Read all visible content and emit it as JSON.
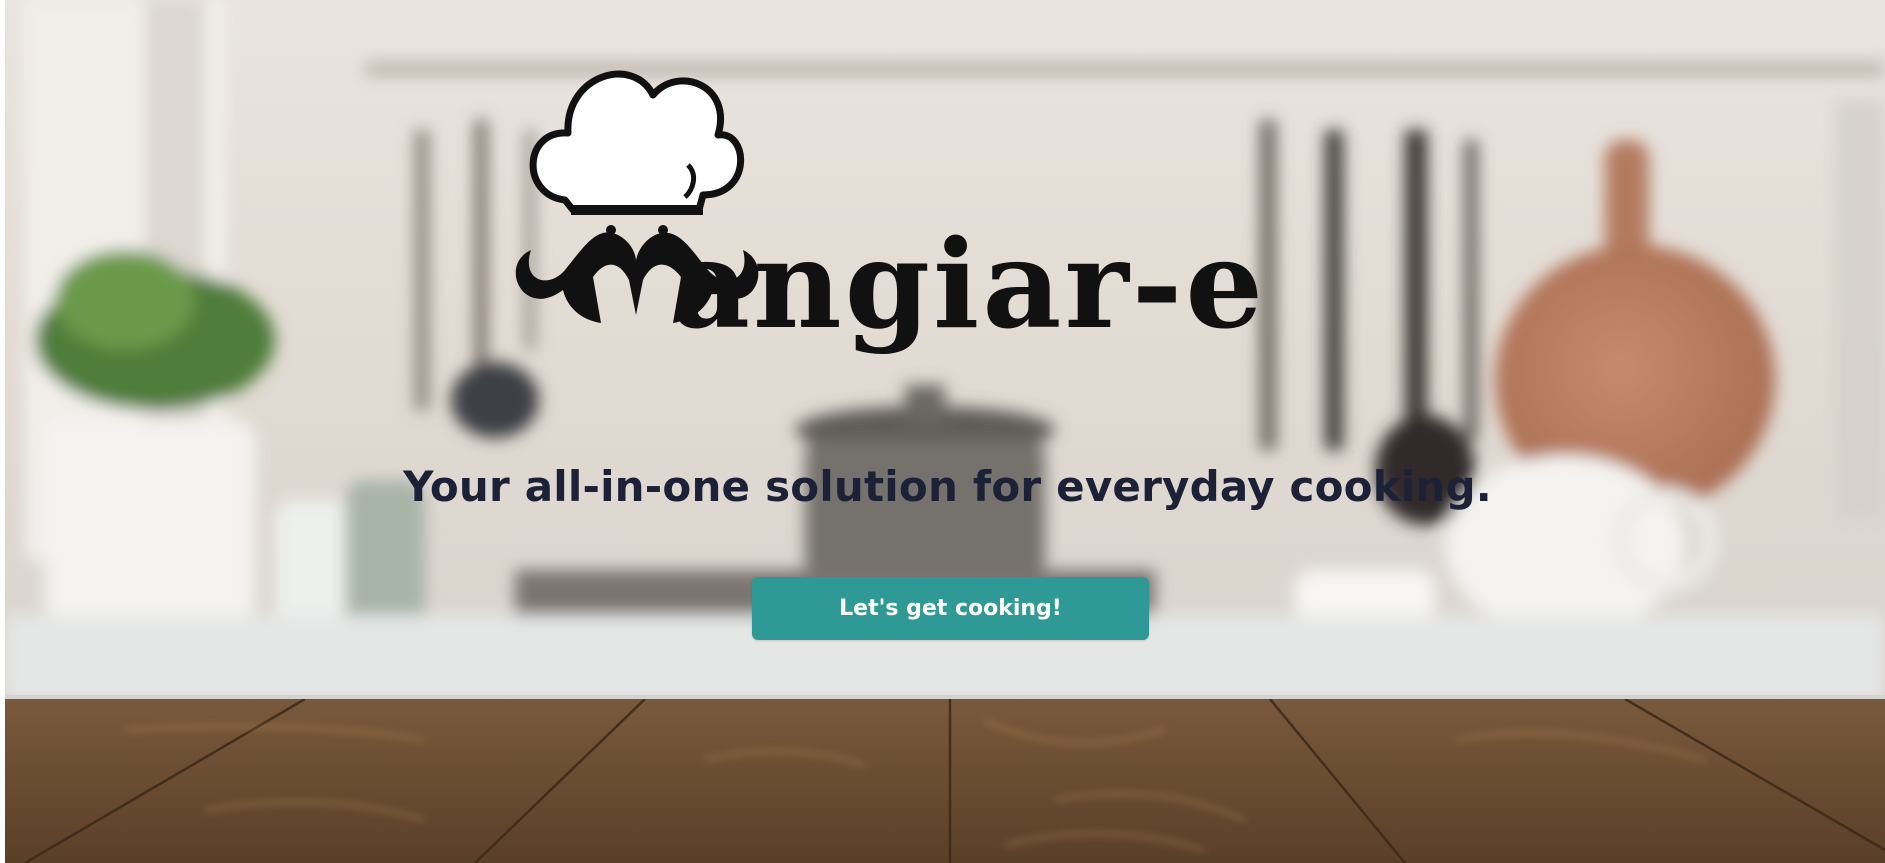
{
  "hero": {
    "brand_name": "angiar-e",
    "tagline": "Your all-in-one solution for everyday cooking.",
    "cta_label": "Let's get cooking!"
  },
  "colors": {
    "cta_background": "#2f9a95",
    "cta_text": "#ffffff",
    "tagline_text": "#1c2137",
    "logo_ink": "#111111",
    "counter_wood": "#6e5035",
    "kitchen_wall": "#ece6df"
  },
  "icons": {
    "logo_mark": "chef-hat-mustache-icon"
  }
}
